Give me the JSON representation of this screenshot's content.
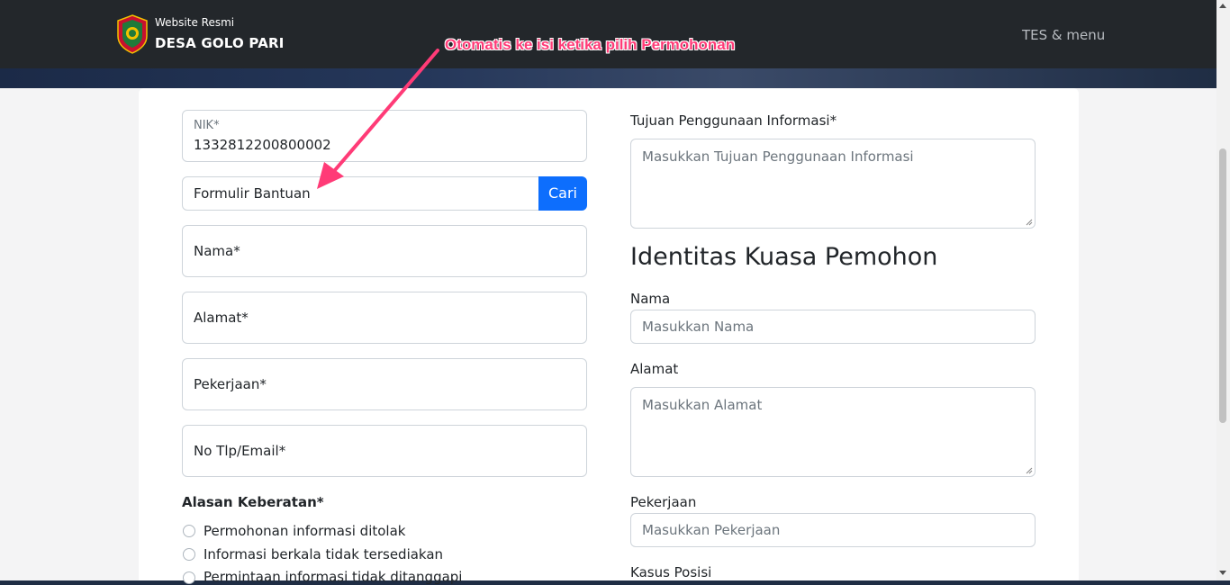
{
  "header": {
    "brand_top": "Website Resmi",
    "brand_main": "DESA GOLO PARI",
    "menu_label": "TES & menu"
  },
  "annotation": {
    "text": "Otomatis ke isi ketika pilih Permohonan",
    "color": "#ff3b77"
  },
  "form_left": {
    "nik": {
      "label": "NIK*",
      "value": "1332812200800002"
    },
    "formulir": {
      "value": "Formulir Bantuan",
      "button": "Cari"
    },
    "nama": {
      "label": "Nama*"
    },
    "alamat": {
      "label": "Alamat*"
    },
    "pekerjaan": {
      "label": "Pekerjaan*"
    },
    "kontak": {
      "label": "No Tlp/Email*"
    },
    "alasan": {
      "title": "Alasan Keberatan*",
      "options": [
        "Permohonan informasi ditolak",
        "Informasi berkala tidak tersediakan",
        "Permintaan informasi tidak ditanggapi"
      ]
    }
  },
  "form_right": {
    "tujuan": {
      "label": "Tujuan Penggunaan Informasi*",
      "placeholder": "Masukkan Tujuan Penggunaan Informasi"
    },
    "heading": "Identitas Kuasa Pemohon",
    "nama": {
      "label": "Nama",
      "placeholder": "Masukkan Nama"
    },
    "alamat": {
      "label": "Alamat",
      "placeholder": "Masukkan Alamat"
    },
    "pekerjaan": {
      "label": "Pekerjaan",
      "placeholder": "Masukkan Pekerjaan"
    },
    "kasus": {
      "label": "Kasus Posisi"
    }
  },
  "colors": {
    "primary": "#0d6efd",
    "navbar": "#23272b"
  }
}
